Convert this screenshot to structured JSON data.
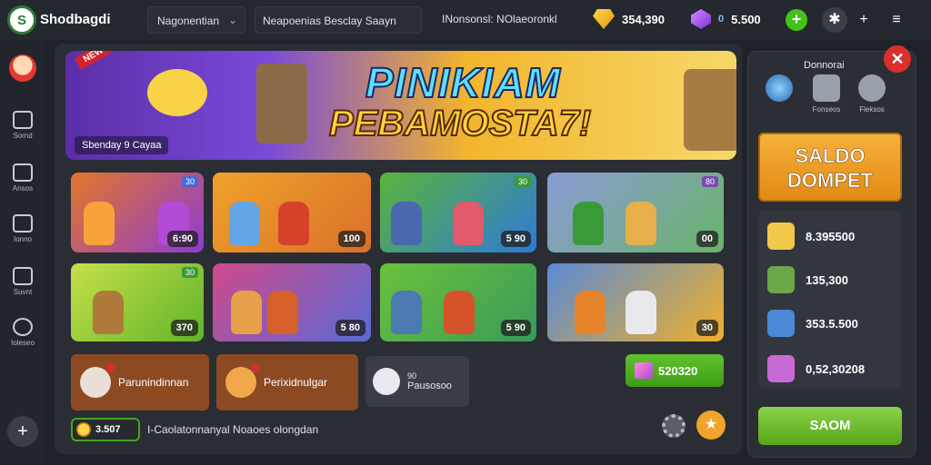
{
  "topbar": {
    "brand": "Shodbagdi",
    "dropdown_label": "Nagonentian",
    "search_text": "Neapoenias Besclay Saayn",
    "notice": "INonsonsl: NOlaeoronkl",
    "gold_amount": "354,390",
    "purple_amount": "5.500",
    "purple_prefix": "0"
  },
  "sidebar": {
    "items": [
      {
        "label": "Sornd",
        "icon": "home-icon"
      },
      {
        "label": "Ansos",
        "icon": "card-icon"
      },
      {
        "label": "Ionno",
        "icon": "edit-icon"
      },
      {
        "label": "Suvnt",
        "icon": "swap-icon"
      },
      {
        "label": "Ioleseo",
        "icon": "chat-icon"
      }
    ]
  },
  "banner": {
    "tag": "NEW",
    "title_line1": "PINIKIAM",
    "title_line2": "PEBAMOSTA7!",
    "subtitle": "Sbenday 9 Cayaa"
  },
  "cards": [
    {
      "price": "6:90",
      "badge": "30"
    },
    {
      "price": "100",
      "badge": ""
    },
    {
      "price": "5 90",
      "badge": "30"
    },
    {
      "price": "00",
      "badge": "80"
    },
    {
      "price": "370",
      "badge": "30"
    },
    {
      "price": "5 80",
      "badge": ""
    },
    {
      "price": "5 90",
      "badge": ""
    },
    {
      "price": "30",
      "badge": ""
    }
  ],
  "bottom": {
    "btn1": "Parunindinnan",
    "btn2": "Perixidnulgar",
    "gray_top": "90",
    "gray_bottom": "Pausosoo",
    "green_amount": "520320",
    "coin_amount": "3.507",
    "footer_text": "I-Caolatonnanyal Noaoes olongdan"
  },
  "right_panel": {
    "header": "Donnorai",
    "tabs": [
      {
        "label": "",
        "icon": "compass-icon"
      },
      {
        "label": "Fonseos",
        "icon": "tag-icon"
      },
      {
        "label": "Fleksos",
        "icon": "gear-icon"
      }
    ],
    "saldo_line1": "SALDO",
    "saldo_line2": "DOMPET",
    "rows": [
      {
        "value": "8.395500"
      },
      {
        "value": "135,300"
      },
      {
        "value": "353.5.500"
      },
      {
        "value": "0,52,30208"
      }
    ],
    "button": "SAOM"
  }
}
